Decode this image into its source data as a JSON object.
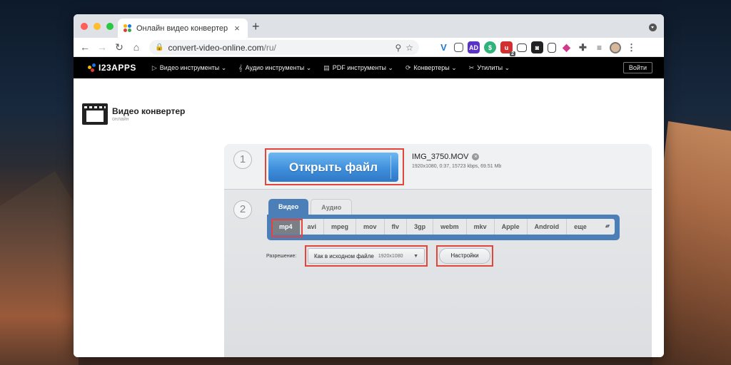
{
  "browser": {
    "tab_title": "Онлайн видео конвертер - ко",
    "new_tab": "+",
    "url_host": "convert-video-online.com",
    "url_path": "/ru/",
    "ext_badge": "2"
  },
  "sitenav": {
    "logo": "I23APPS",
    "items": [
      {
        "label": "Видео инструменты ⌄",
        "icon": "▷"
      },
      {
        "label": "Аудио инструменты ⌄",
        "icon": "𝄞"
      },
      {
        "label": "PDF инструменты ⌄",
        "icon": "▤"
      },
      {
        "label": "Конвертеры ⌄",
        "icon": "⟳"
      },
      {
        "label": "Утилиты ⌄",
        "icon": "✂"
      }
    ],
    "login": "Войти"
  },
  "product": {
    "title": "Видео конвертер",
    "subtitle": "онлайн"
  },
  "converter": {
    "step1_num": "1",
    "step2_num": "2",
    "open_file": "Открыть файл",
    "file_name": "IMG_3750.MOV",
    "file_meta": "1920x1080, 0:37, 15723 kbps, 69.51 Mb",
    "tabs": [
      "Видео",
      "Аудио"
    ],
    "formats": [
      "mp4",
      "avi",
      "mpeg",
      "mov",
      "flv",
      "3gp",
      "webm",
      "mkv",
      "Apple",
      "Android",
      "еще"
    ],
    "selected_format": "mp4",
    "resolution_label": "Разрешение:",
    "resolution_value": "Как в исходном файле",
    "resolution_dim": "1920x1080",
    "settings": "Настройки"
  },
  "colors": {
    "accent_blue": "#4c7fb8",
    "highlight_red": "#e2453a",
    "open_button": "#3f8fdc"
  }
}
